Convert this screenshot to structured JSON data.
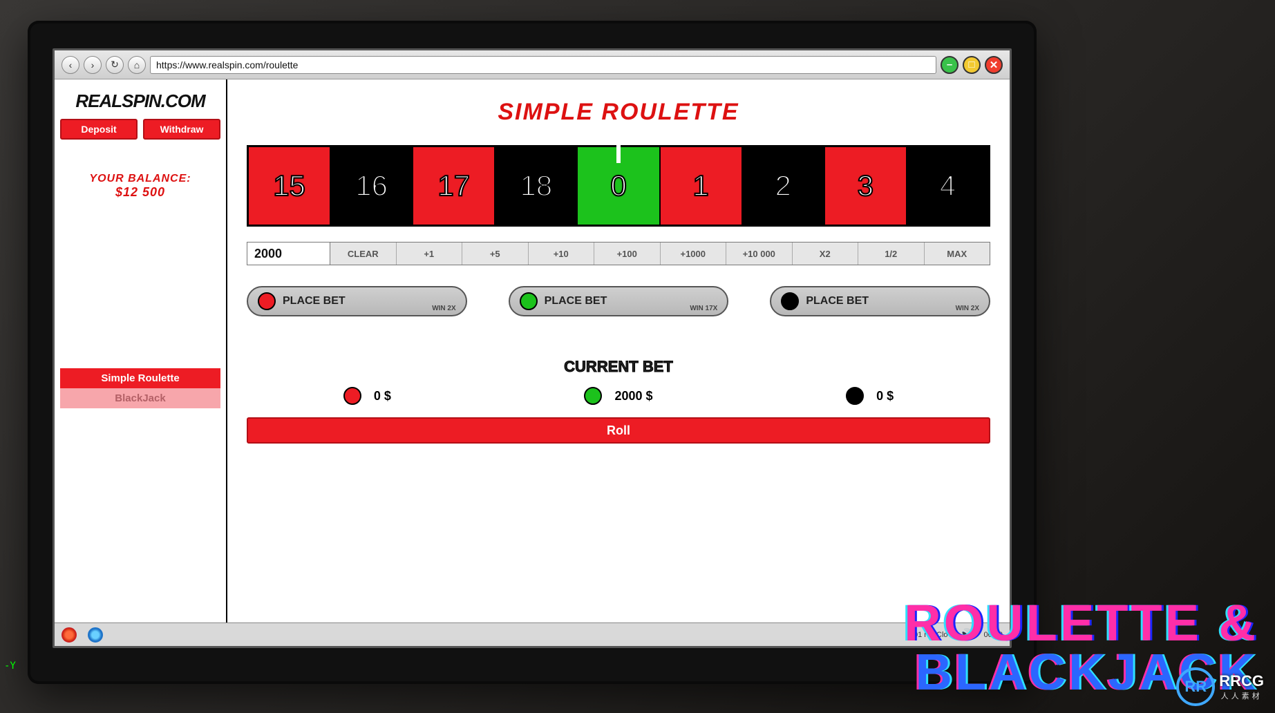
{
  "browser": {
    "url": "https://www.realspin.com/roulette"
  },
  "sidebar": {
    "logo": "REALSPIN.COM",
    "deposit": "Deposit",
    "withdraw": "Withdraw",
    "balance_label": "YOUR BALANCE:",
    "balance_value": "$12 500",
    "tab_active": "Simple Roulette",
    "tab_inactive": "BlackJack"
  },
  "main": {
    "title": "SIMPLE ROULETTE",
    "wheel": [
      {
        "n": "15",
        "c": "red"
      },
      {
        "n": "16",
        "c": "black"
      },
      {
        "n": "17",
        "c": "red"
      },
      {
        "n": "18",
        "c": "black"
      },
      {
        "n": "0",
        "c": "green",
        "pointer": true
      },
      {
        "n": "1",
        "c": "red"
      },
      {
        "n": "2",
        "c": "black"
      },
      {
        "n": "3",
        "c": "red"
      },
      {
        "n": "4",
        "c": "black"
      }
    ],
    "amount_value": "2000",
    "amount_buttons": [
      "CLEAR",
      "+1",
      "+5",
      "+10",
      "+100",
      "+1000",
      "+10 000",
      "X2",
      "1/2",
      "MAX"
    ],
    "bets": [
      {
        "chip": "r",
        "label": "PLACE BET",
        "win": "WIN 2X"
      },
      {
        "chip": "g",
        "label": "PLACE BET",
        "win": "WIN 17X"
      },
      {
        "chip": "b",
        "label": "PLACE BET",
        "win": "WIN 2X"
      }
    ],
    "current_bet_title": "CURRENT BET",
    "current_bets": [
      {
        "chip": "r",
        "text": "0 $"
      },
      {
        "chip": "g",
        "text": "2000 $"
      },
      {
        "chip": "b",
        "text": "0 $"
      }
    ],
    "roll": "Roll"
  },
  "taskbar": {
    "status": "0.01  rtly Clo",
    "time": "00:00"
  },
  "overlay": {
    "line1": "ROULETTE &",
    "line2": "BLACKJACK"
  },
  "watermark": {
    "logo_letters": "RR",
    "text": "RRCG",
    "sub": "人人素材"
  },
  "axis": "-Y"
}
